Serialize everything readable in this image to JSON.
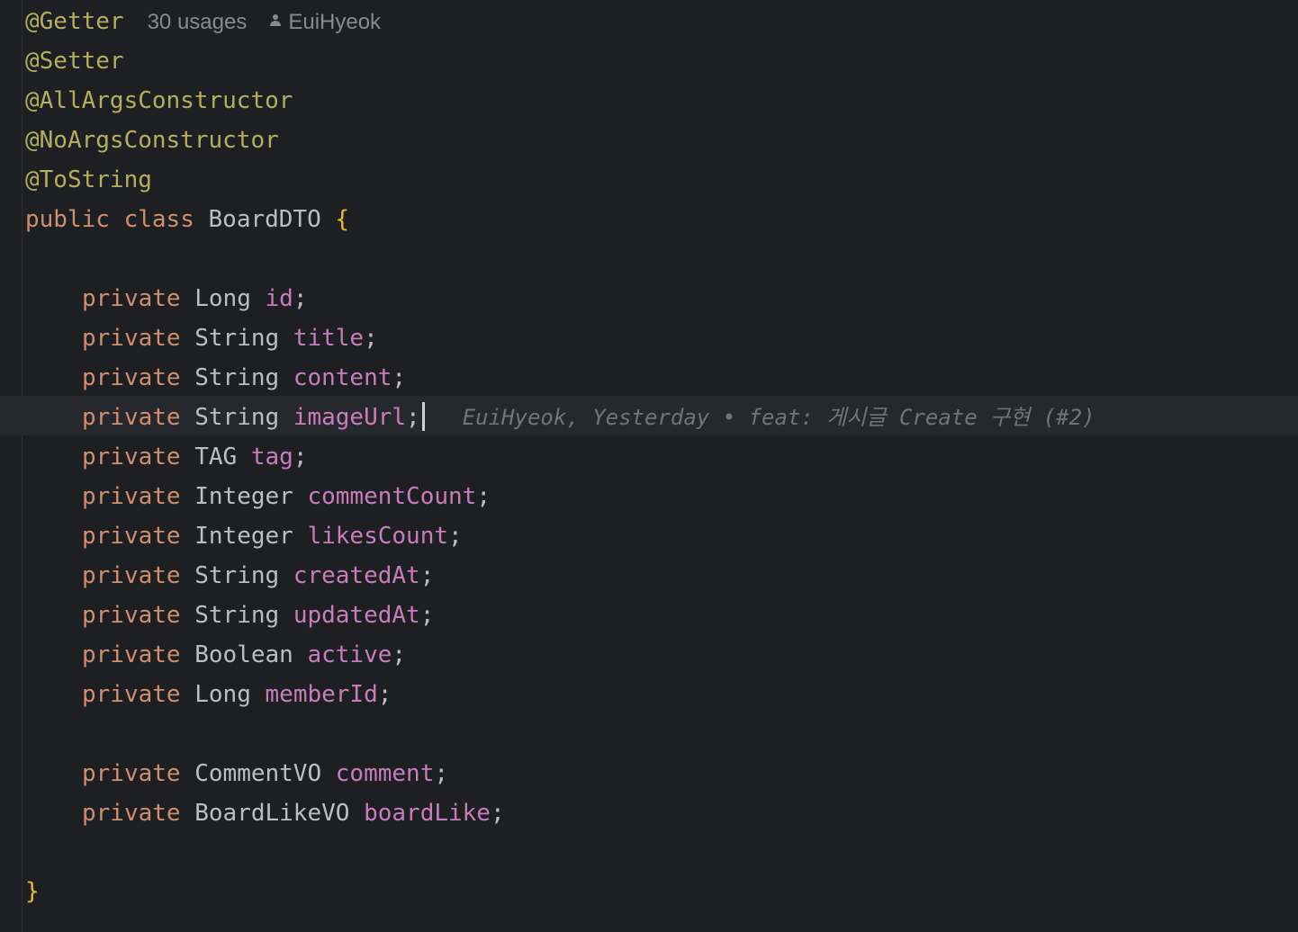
{
  "inlay": {
    "usages": "30 usages",
    "author": "EuiHyeok",
    "person_icon": "person-icon"
  },
  "annotations": [
    "@Getter",
    "@Setter",
    "@AllArgsConstructor",
    "@NoArgsConstructor",
    "@ToString"
  ],
  "class_decl": {
    "modifier": "public",
    "keyword": "class",
    "name": "BoardDTO",
    "open_brace": "{",
    "close_brace": "}"
  },
  "fields": [
    {
      "modifier": "private",
      "type": "Long",
      "name": "id"
    },
    {
      "modifier": "private",
      "type": "String",
      "name": "title"
    },
    {
      "modifier": "private",
      "type": "String",
      "name": "content"
    },
    {
      "modifier": "private",
      "type": "String",
      "name": "imageUrl"
    },
    {
      "modifier": "private",
      "type": "TAG",
      "name": "tag"
    },
    {
      "modifier": "private",
      "type": "Integer",
      "name": "commentCount"
    },
    {
      "modifier": "private",
      "type": "Integer",
      "name": "likesCount"
    },
    {
      "modifier": "private",
      "type": "String",
      "name": "createdAt"
    },
    {
      "modifier": "private",
      "type": "String",
      "name": "updatedAt"
    },
    {
      "modifier": "private",
      "type": "Boolean",
      "name": "active"
    },
    {
      "modifier": "private",
      "type": "Long",
      "name": "memberId"
    },
    {
      "modifier": "private",
      "type": "CommentVO",
      "name": "comment"
    },
    {
      "modifier": "private",
      "type": "BoardLikeVO",
      "name": "boardLike"
    }
  ],
  "semicolon": ";",
  "blame": {
    "text": "EuiHyeok, Yesterday • feat: 게시글 Create 구현 (#2)"
  },
  "colors": {
    "background": "#1e1f22",
    "annotation": "#b3ae60",
    "keyword": "#cf8e6d",
    "field": "#c77dbb",
    "text": "#bcbec4",
    "brace": "#e8ba36",
    "hint": "#868a91"
  }
}
